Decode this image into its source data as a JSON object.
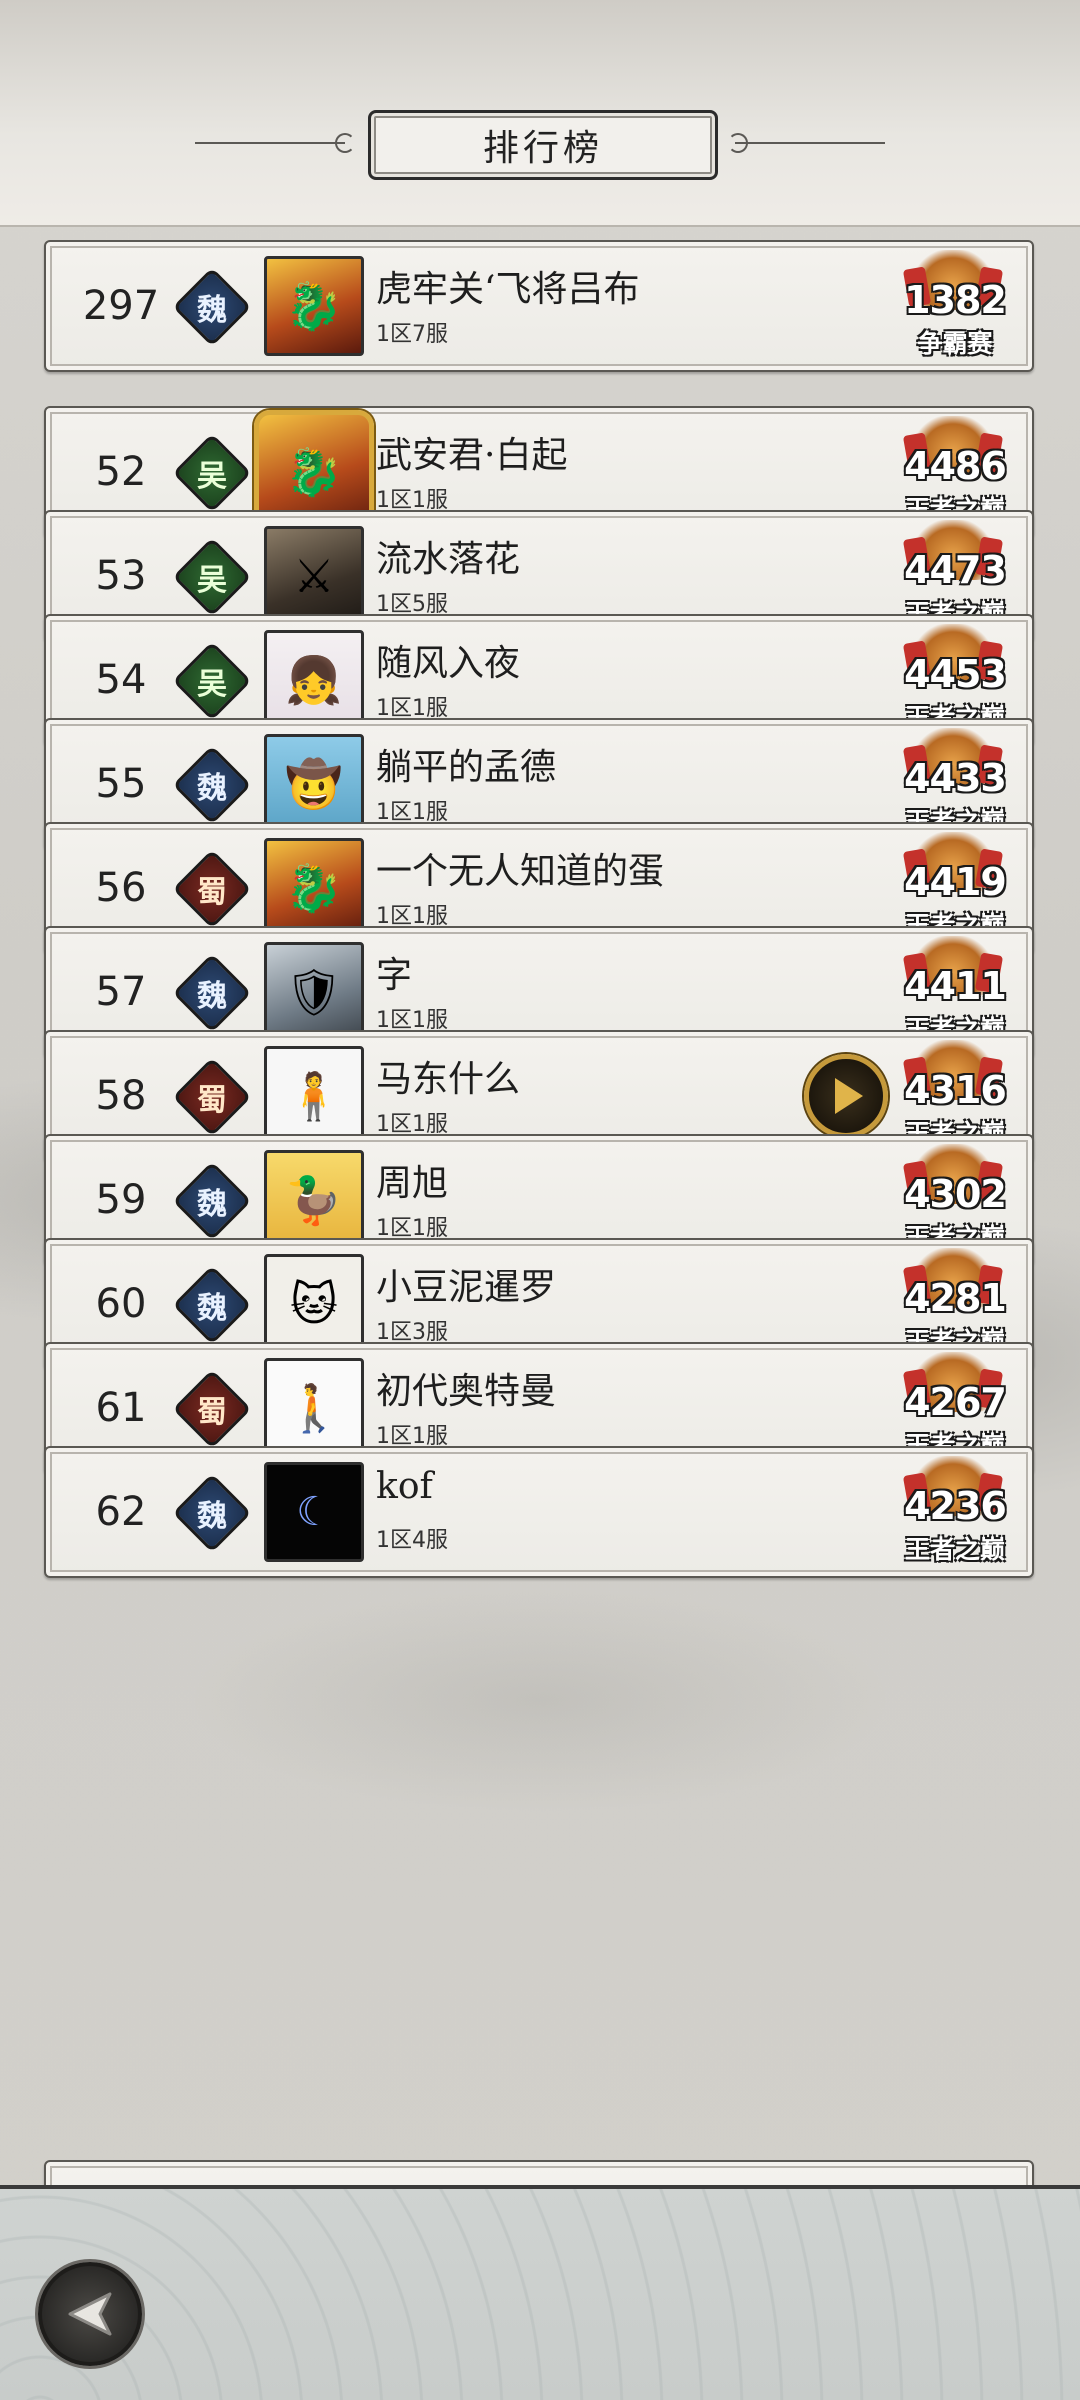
{
  "header": {
    "title": "排行榜"
  },
  "colors": {
    "wei": "#1c2f4d",
    "wu": "#1c431e",
    "shu": "#4d1712",
    "badge_gold": "#c69a3b"
  },
  "rows": [
    {
      "rank": "297",
      "faction": "魏",
      "faction_key": "wei",
      "avatar": "hero-helmet-avatar",
      "avatar_style": "av-hero",
      "name": "虎牢关‘飞将吕布",
      "server": "1区7服",
      "score": "1382",
      "tier": "争霸赛"
    },
    {
      "rank": "52",
      "faction": "吴",
      "faction_key": "wu",
      "avatar": "hero-gold-frame-avatar",
      "avatar_style": "av-hero",
      "gold": true,
      "name": "武安君·白起",
      "server": "1区1服",
      "score": "4486",
      "tier": "王者之巅"
    },
    {
      "rank": "53",
      "faction": "吴",
      "faction_key": "wu",
      "avatar": "warrior-avatar",
      "avatar_style": "av-hero2",
      "name": "流水落花",
      "server": "1区5服",
      "score": "4473",
      "tier": "王者之巅"
    },
    {
      "rank": "54",
      "faction": "吴",
      "faction_key": "wu",
      "avatar": "girl-avatar",
      "avatar_style": "av-girl",
      "name": "随风入夜",
      "server": "1区1服",
      "score": "4453",
      "tier": "王者之巅"
    },
    {
      "rank": "55",
      "faction": "魏",
      "faction_key": "wei",
      "avatar": "cowboy-avatar",
      "avatar_style": "av-cowboy",
      "name": "躺平的孟德",
      "server": "1区1服",
      "score": "4433",
      "tier": "王者之巅"
    },
    {
      "rank": "56",
      "faction": "蜀",
      "faction_key": "shu",
      "avatar": "hero-helmet-avatar",
      "avatar_style": "av-hero",
      "name": "一个无人知道的蛋",
      "server": "1区1服",
      "score": "4419",
      "tier": "王者之巅"
    },
    {
      "rank": "57",
      "faction": "魏",
      "faction_key": "wei",
      "avatar": "helmet-soldier-avatar",
      "avatar_style": "av-helmet",
      "name": "字",
      "server": "1区1服",
      "score": "4411",
      "tier": "王者之巅"
    },
    {
      "rank": "58",
      "faction": "蜀",
      "faction_key": "shu",
      "avatar": "person-avatar",
      "avatar_style": "av-person",
      "name": "马东什么",
      "server": "1区1服",
      "score": "4316",
      "tier": "王者之巅",
      "play": true
    },
    {
      "rank": "59",
      "faction": "魏",
      "faction_key": "wei",
      "avatar": "duck-avatar",
      "avatar_style": "av-duck",
      "name": "周旭",
      "server": "1区1服",
      "score": "4302",
      "tier": "王者之巅"
    },
    {
      "rank": "60",
      "faction": "魏",
      "faction_key": "wei",
      "avatar": "cat-avatar",
      "avatar_style": "av-cat",
      "name": "小豆泥暹罗",
      "server": "1区3服",
      "score": "4281",
      "tier": "王者之巅"
    },
    {
      "rank": "61",
      "faction": "蜀",
      "faction_key": "shu",
      "avatar": "sketch-avatar",
      "avatar_style": "av-sketch",
      "name": "初代奥特曼",
      "server": "1区1服",
      "score": "4267",
      "tier": "王者之巅"
    },
    {
      "rank": "62",
      "faction": "魏",
      "faction_key": "wei",
      "avatar": "moon-avatar",
      "avatar_style": "av-moon",
      "name": "kof",
      "server": "1区4服",
      "score": "4236",
      "tier": "王者之巅"
    }
  ],
  "footer": {
    "back_icon": "back-arrow-icon"
  }
}
